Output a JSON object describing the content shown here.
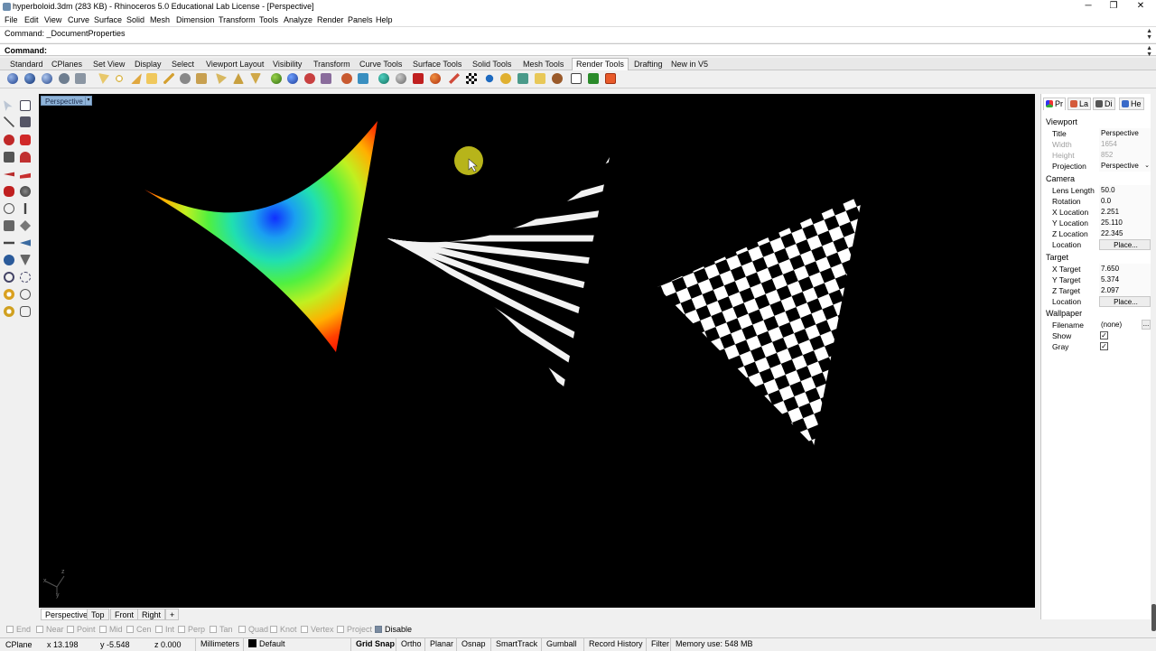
{
  "window": {
    "title": "hyperboloid.3dm (283 KB) - Rhinoceros 5.0 Educational Lab License - [Perspective]",
    "minimize": "─",
    "restore": "❐",
    "close": "✕"
  },
  "menu": [
    "File",
    "Edit",
    "View",
    "Curve",
    "Surface",
    "Solid",
    "Mesh",
    "Dimension",
    "Transform",
    "Tools",
    "Analyze",
    "Render",
    "Panels",
    "Help"
  ],
  "command": {
    "history": "Command: _DocumentProperties",
    "prompt_label": "Command:",
    "input_value": ""
  },
  "toolbar_tabs": [
    "Standard",
    "CPlanes",
    "Set View",
    "Display",
    "Select",
    "Viewport Layout",
    "Visibility",
    "Transform",
    "Curve Tools",
    "Surface Tools",
    "Solid Tools",
    "Mesh Tools",
    "Render Tools",
    "Drafting",
    "New in V5"
  ],
  "active_toolbar_tab": "Render Tools",
  "viewport": {
    "label": "Perspective",
    "axis_z": "z",
    "axis_x": "x",
    "axis_y": "y"
  },
  "viewport_tabs": [
    "Perspective",
    "Top",
    "Front",
    "Right"
  ],
  "add_viewport_icon": "+",
  "osnaps": [
    {
      "label": "End",
      "on": false
    },
    {
      "label": "Near",
      "on": false
    },
    {
      "label": "Point",
      "on": false
    },
    {
      "label": "Mid",
      "on": false
    },
    {
      "label": "Cen",
      "on": false
    },
    {
      "label": "Int",
      "on": false
    },
    {
      "label": "Perp",
      "on": false
    },
    {
      "label": "Tan",
      "on": false
    },
    {
      "label": "Quad",
      "on": false
    },
    {
      "label": "Knot",
      "on": false
    },
    {
      "label": "Vertex",
      "on": false
    },
    {
      "label": "Project",
      "on": false
    },
    {
      "label": "Disable",
      "on": true
    }
  ],
  "status": {
    "cplane": "CPlane",
    "x": "x 13.198",
    "y": "y -5.548",
    "z": "z 0.000",
    "units": "Millimeters",
    "layer": "Default",
    "grid_snap": "Grid Snap",
    "ortho": "Ortho",
    "planar": "Planar",
    "osnap": "Osnap",
    "smarttrack": "SmartTrack",
    "gumball": "Gumball",
    "record_history": "Record History",
    "filter": "Filter",
    "memory": "Memory use: 548 MB"
  },
  "properties_panel": {
    "tabs": [
      "Pr",
      "La",
      "Di",
      "He"
    ],
    "viewport_section": "Viewport",
    "title_label": "Title",
    "title_value": "Perspective",
    "width_label": "Width",
    "width_value": "1654",
    "height_label": "Height",
    "height_value": "852",
    "projection_label": "Projection",
    "projection_value": "Perspective",
    "camera_section": "Camera",
    "lens_label": "Lens Length",
    "lens_value": "50.0",
    "rotation_label": "Rotation",
    "rotation_value": "0.0",
    "cam_x_label": "X Location",
    "cam_x_value": "2.251",
    "cam_y_label": "Y Location",
    "cam_y_value": "25.110",
    "cam_z_label": "Z Location",
    "cam_z_value": "22.345",
    "cam_loc_label": "Location",
    "cam_loc_button": "Place...",
    "target_section": "Target",
    "tx_label": "X Target",
    "tx_value": "7.650",
    "ty_label": "Y Target",
    "ty_value": "5.374",
    "tz_label": "Z Target",
    "tz_value": "2.097",
    "target_loc_label": "Location",
    "target_loc_button": "Place...",
    "wallpaper_section": "Wallpaper",
    "filename_label": "Filename",
    "filename_value": "(none)",
    "filename_browse": "...",
    "show_label": "Show",
    "show_checked": true,
    "gray_label": "Gray",
    "gray_checked": true
  },
  "colors": {
    "viewport_bg": "#000000",
    "viewport_tab": "#8fb4d9",
    "cursor_highlight": "#d7d31e"
  }
}
